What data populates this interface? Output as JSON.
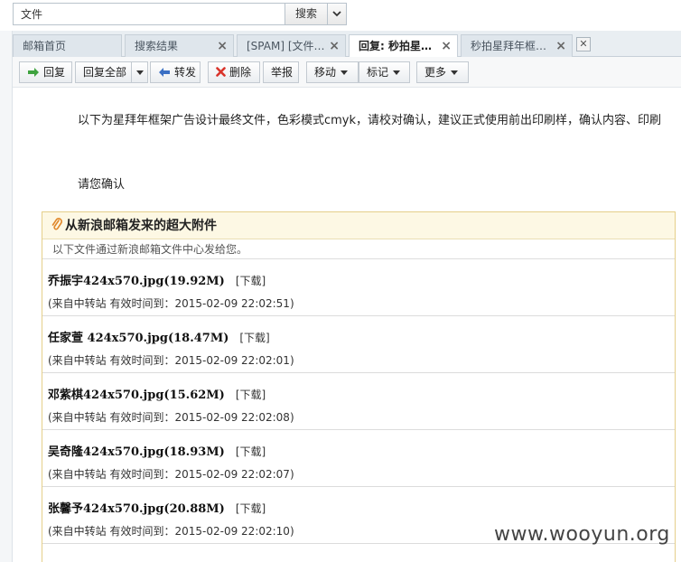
{
  "search": {
    "value": "文件",
    "button_label": "搜索"
  },
  "tabs": [
    {
      "label": "邮箱首页",
      "closable": false
    },
    {
      "label": "搜索结果",
      "closable": true
    },
    {
      "label": "[SPAM] [文件…",
      "closable": true
    },
    {
      "label": "回复: 秒拍星…",
      "closable": true,
      "active": true
    },
    {
      "label": "秒拍星拜年框…",
      "closable": true
    }
  ],
  "toolbar": {
    "reply": "回复",
    "reply_all": "回复全部",
    "forward": "转发",
    "delete": "删除",
    "report": "举报",
    "move": "移动",
    "mark": "标记",
    "more": "更多"
  },
  "message": {
    "line1": "以下为星拜年框架广告设计最终文件，色彩模式cmyk，请校对确认，建议正式使用前出印刷样，确认内容、印刷",
    "line2": "请您确认"
  },
  "attachments": {
    "title": "从新浪邮箱发来的超大附件",
    "subtitle": "以下文件通过新浪邮箱文件中心发给您。",
    "download_label": "[下载]",
    "files": [
      {
        "name": "乔振宇424x570.jpg(19.92M)",
        "meta": "(来自中转站 有效时间到：2015-02-09 22:02:51)"
      },
      {
        "name": "任家萱 424x570.jpg(18.47M)",
        "meta": "(来自中转站 有效时间到：2015-02-09 22:02:01)"
      },
      {
        "name": "邓紫棋424x570.jpg(15.62M)",
        "meta": "(来自中转站 有效时间到：2015-02-09 22:02:08)"
      },
      {
        "name": "吴奇隆424x570.jpg(18.93M)",
        "meta": "(来自中转站 有效时间到：2015-02-09 22:02:07)"
      },
      {
        "name": "张馨予424x570.jpg(20.88M)",
        "meta": "(来自中转站 有效时间到：2015-02-09 22:02:10)"
      }
    ]
  },
  "watermark": "www.wooyun.org",
  "colors": {
    "reply_arrow": "#3fa33f",
    "forward_arrow": "#3a6fc4",
    "delete_x": "#d9342b",
    "attach_border": "#e5cf8a"
  }
}
